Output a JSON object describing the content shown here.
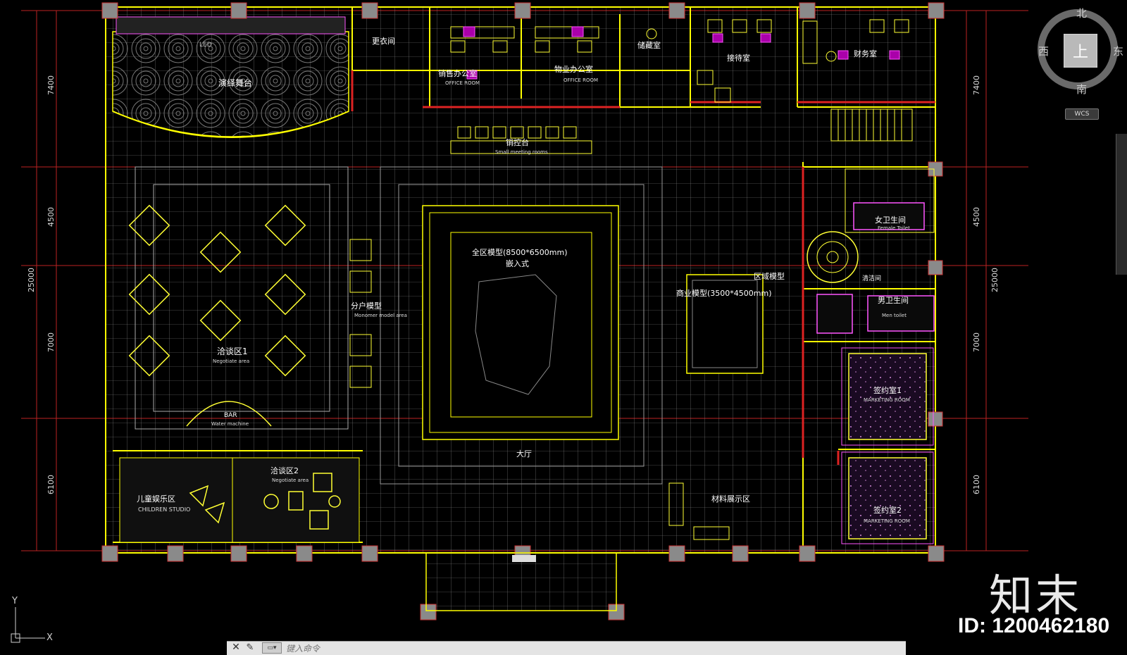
{
  "viewcube": {
    "north": "北",
    "south": "南",
    "west": "西",
    "east": "东",
    "top": "上",
    "wcs": "WCS"
  },
  "brand": {
    "logo": "知末",
    "id": "ID: 1200462180"
  },
  "command": {
    "placeholder": "键入命令"
  },
  "ucs": {
    "y": "Y",
    "x": "X"
  },
  "dims": {
    "left": [
      "7400",
      "4500",
      "7000",
      "6100"
    ],
    "left_total": "25000",
    "right": [
      "7400",
      "4500",
      "7000",
      "6100"
    ],
    "right_total": "25000"
  },
  "rooms": {
    "stage": "演绎舞台",
    "led": "LED",
    "changing": "更衣间",
    "sales_office": "销售办公室",
    "office_room": "OFFICE ROOM",
    "property_office": "物业办公室",
    "office_room2": "OFFICE ROOM",
    "storage": "储藏室",
    "reception": "接待室",
    "finance": "财务室",
    "sales_desk": "销控台",
    "small_meeting": "Small meeting rooms",
    "negotiate1": "洽谈区1",
    "negotiate_area": "Negotiate area",
    "bar": "BAR",
    "water": "Water machine",
    "unit_model": "分户模型",
    "unit_model_en": "Monomer model area",
    "master_model": "全区模型(8500*6500mm)",
    "embedded": "嵌入式",
    "commercial_model": "商业模型(3500*4500mm)",
    "zone_model": "区域模型",
    "hall": "大厅",
    "negotiate2": "洽谈区2",
    "negotiate2_en": "Negotiate area",
    "children": "儿童娱乐区",
    "children_en": "CHILDREN STUDIO",
    "material": "材料展示区",
    "female_toilet": "女卫生间",
    "female_toilet_en": "Female Toilet",
    "male_toilet": "男卫生间",
    "male_toilet_en": "Men toilet",
    "cleaning": "清洁间",
    "sign1": "签约室1",
    "sign1_en": "MARKETING ROOM",
    "sign2": "签约室2",
    "sign2_en": "MARKETING ROOM"
  },
  "colors": {
    "wall": "#ffff00",
    "grid": "#9a9a9a",
    "dim": "#ff3333",
    "furniture": "#ffff33",
    "accent": "#ff00ff"
  }
}
